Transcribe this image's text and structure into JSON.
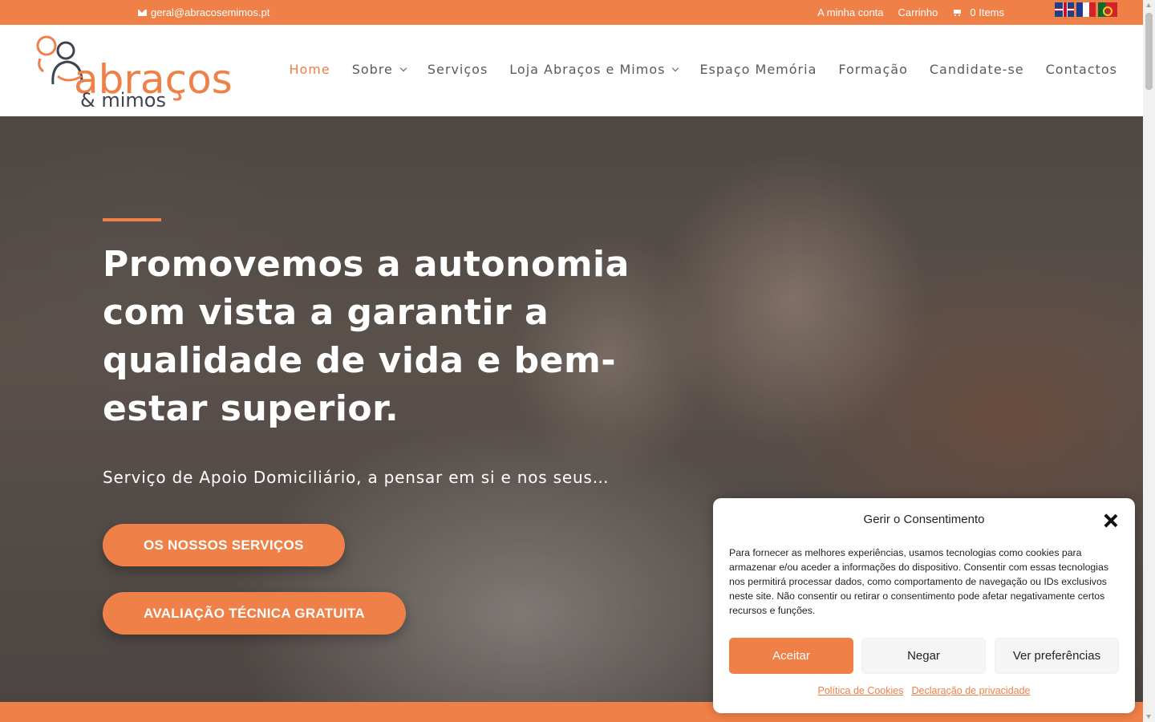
{
  "topbar": {
    "email": "geral@abracosemimos.pt",
    "links": [
      "A minha conta",
      "Carrinho"
    ],
    "cart_label": "0 Items",
    "flags": [
      "english-flag",
      "french-flag",
      "portuguese-flag"
    ]
  },
  "logo": {
    "name": "abraços",
    "tagline": "& mimos"
  },
  "nav": {
    "items": [
      "Home",
      "Sobre",
      "Serviços",
      "Loja Abraços e Mimos",
      "Espaço Memória",
      "Formação",
      "Candidate-se",
      "Contactos"
    ],
    "active": "Home"
  },
  "hero": {
    "title": "Promovemos a autonomia com vista a garantir a qualidade de vida e bem-estar superior.",
    "subtitle": "Serviço de Apoio Domiciliário, a pensar em si e nos seus…",
    "button_services": "OS NOSSOS SERVIÇOS",
    "button_evaluation": "AVALIAÇÃO TÉCNICA GRATUITA"
  },
  "consent": {
    "title": "Gerir o Consentimento",
    "text": "Para fornecer as melhores experiências, usamos tecnologias como cookies para armazenar e/ou aceder a informações do dispositivo. Consentir com essas tecnologias nos permitirá processar dados, como comportamento de navegação ou IDs exclusivos neste site. Não consentir ou retirar o consentimento pode afetar negativamente certos recursos e funções.",
    "accept": "Aceitar",
    "deny": "Negar",
    "preferences": "Ver preferências",
    "cookie_policy": "Política de Cookies",
    "privacy_statement": "Declaração de privacidade"
  },
  "colors": {
    "accent": "#ef8048",
    "nav_text": "#5a5a5a",
    "logo_dark": "#3d4450"
  }
}
